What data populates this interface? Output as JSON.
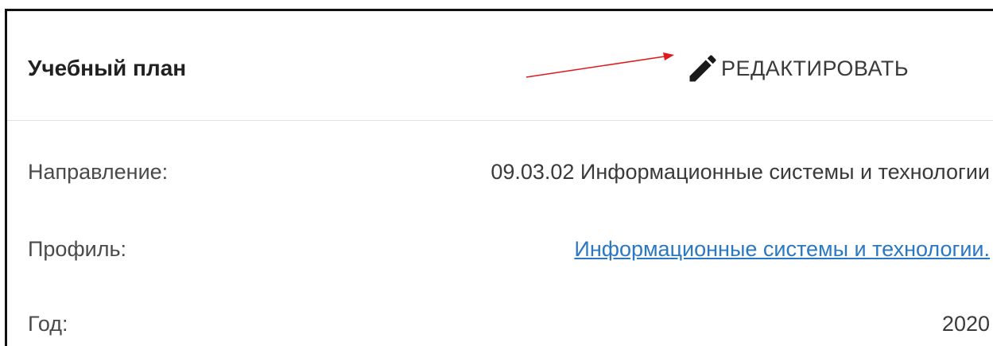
{
  "card": {
    "title": "Учебный план",
    "edit_label": "РЕДАКТИРОВАТЬ",
    "edit_icon": "pencil-icon"
  },
  "annotation": {
    "color": "#e0191c"
  },
  "fields": [
    {
      "label": "Направление:",
      "value": "09.03.02 Информационные системы и технологии"
    },
    {
      "label": "Профиль:",
      "value": "Информационные системы и технологии."
    },
    {
      "label": "Год:",
      "value": "2020"
    }
  ],
  "colors": {
    "link": "#2a78c2",
    "text": "#3a3a3a"
  }
}
